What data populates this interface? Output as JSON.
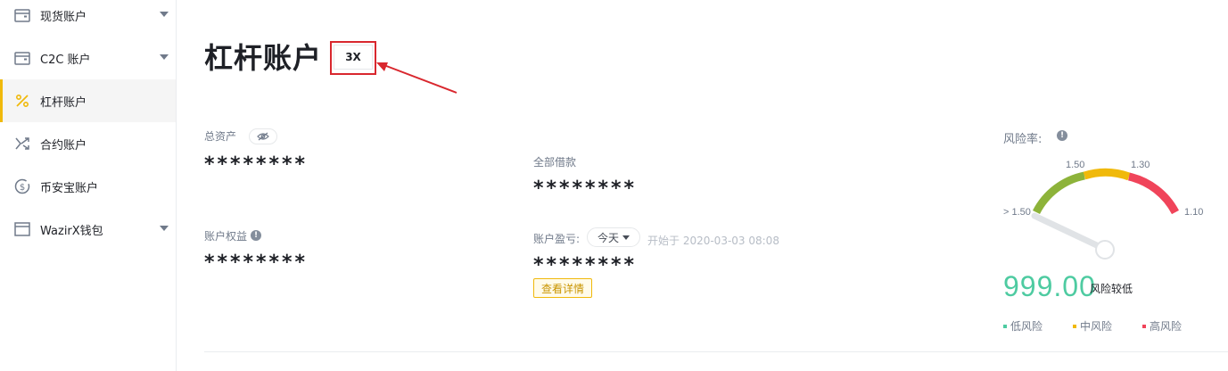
{
  "sidebar": {
    "items": [
      {
        "label": "现货账户"
      },
      {
        "label": "C2C 账户"
      },
      {
        "label": "杠杆账户"
      },
      {
        "label": "合约账户"
      },
      {
        "label": "币安宝账户"
      },
      {
        "label": "WazirX钱包"
      }
    ]
  },
  "header": {
    "title": "杠杆账户",
    "leverage": "3X"
  },
  "assets": {
    "total_label": "总资产",
    "total_value": "********",
    "equity_label": "账户权益",
    "equity_value": "********",
    "borrowed_label": "全部借款",
    "borrowed_value": "********",
    "pnl_label": "账户盈亏:",
    "pnl_period": "今天",
    "pnl_since": "开始于 2020-03-03 08:08",
    "pnl_value": "********",
    "details_button": "查看详情"
  },
  "risk": {
    "label": "风险率:",
    "value": "999.00",
    "level": "风险较低",
    "gauge_labels": {
      "left": "> 1.50",
      "t1": "1.50",
      "t2": "1.30",
      "right": "1.10"
    },
    "colors": {
      "low": "#4ecba1",
      "mid": "#f0b90b",
      "high": "#f0445a",
      "green_arc": "#8db33a"
    },
    "legend": [
      {
        "label": "低风险",
        "color": "#4ecba1"
      },
      {
        "label": "中风险",
        "color": "#f0b90b"
      },
      {
        "label": "高风险",
        "color": "#f0445a"
      }
    ]
  },
  "theme": {
    "accent": "#f0b90b",
    "annotation_red": "#d9272e"
  }
}
